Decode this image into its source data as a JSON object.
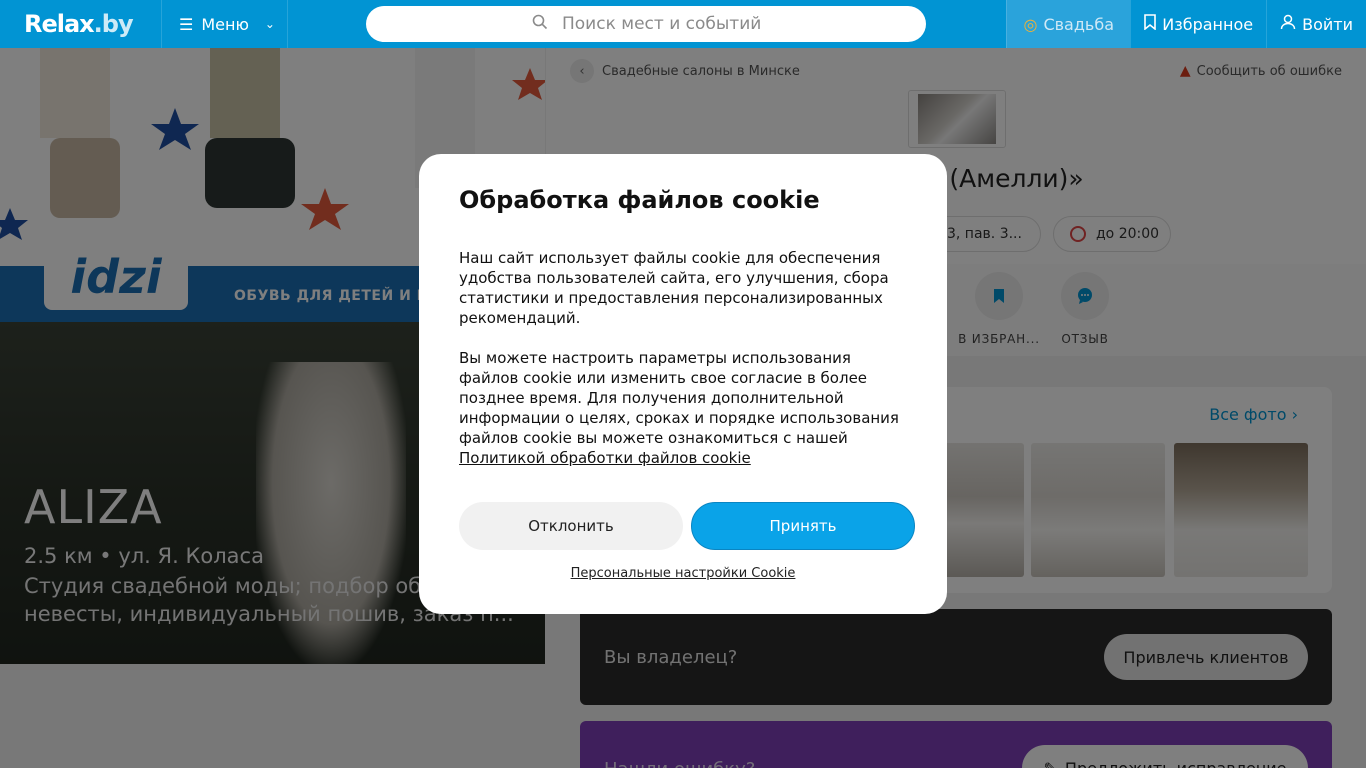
{
  "header": {
    "logo_main": "Relax",
    "logo_suffix": ".by",
    "menu_label": "Меню",
    "search_placeholder": "Поиск мест и событий",
    "wedding_label": "Свадьба",
    "favorites_label": "Избранное",
    "login_label": "Войти"
  },
  "banner": {
    "logo_text": "idzi",
    "slogan": "ОБУВЬ ДЛЯ ДЕТЕЙ И П"
  },
  "promo": {
    "title": "ALIZA",
    "distance": "2.5 км • ул. Я. Коласа",
    "description": "Студия свадебной моды; подбор об... невесты, индивидуальный пошив, заказ п..."
  },
  "place": {
    "breadcrumb": "Свадебные салоны в Минске",
    "report_label": "Сообщить об ошибке",
    "title": "и «Amelli (Амелли)»",
    "address": "3, пав. 3...",
    "hours": "до 20:00",
    "actions": [
      {
        "label": "В ИЗБРАН..."
      },
      {
        "label": "ОТЗЫВ"
      }
    ],
    "all_photos_label": "Все фото",
    "owner_text": "Вы владелец?",
    "owner_button": "Привлечь клиентов",
    "mistake_text": "Нашли ошибку?",
    "mistake_button": "Предложить исправление"
  },
  "cookie_modal": {
    "title": "Обработка файлов cookie",
    "paragraph1": "Наш сайт использует файлы cookie для обеспечения удобства пользователей сайта, его улучшения, сбора статистики и предоставления персонализированных рекомендаций.",
    "paragraph2": "Вы можете настроить параметры использования файлов cookie или изменить свое согласие в более позднее время. Для получения дополнительной информации о целях, сроках и порядке использования файлов cookie вы можете ознакомиться с нашей",
    "policy_link": "Политикой обработки файлов cookie",
    "decline_label": "Отклонить",
    "accept_label": "Принять",
    "settings_link": "Персональные настройки Cookie"
  },
  "colors": {
    "brand": "#0194d3",
    "accept": "#0aa3e8",
    "owner_bg": "#2b2b2b",
    "mistake_bg": "#7e3fb8"
  }
}
